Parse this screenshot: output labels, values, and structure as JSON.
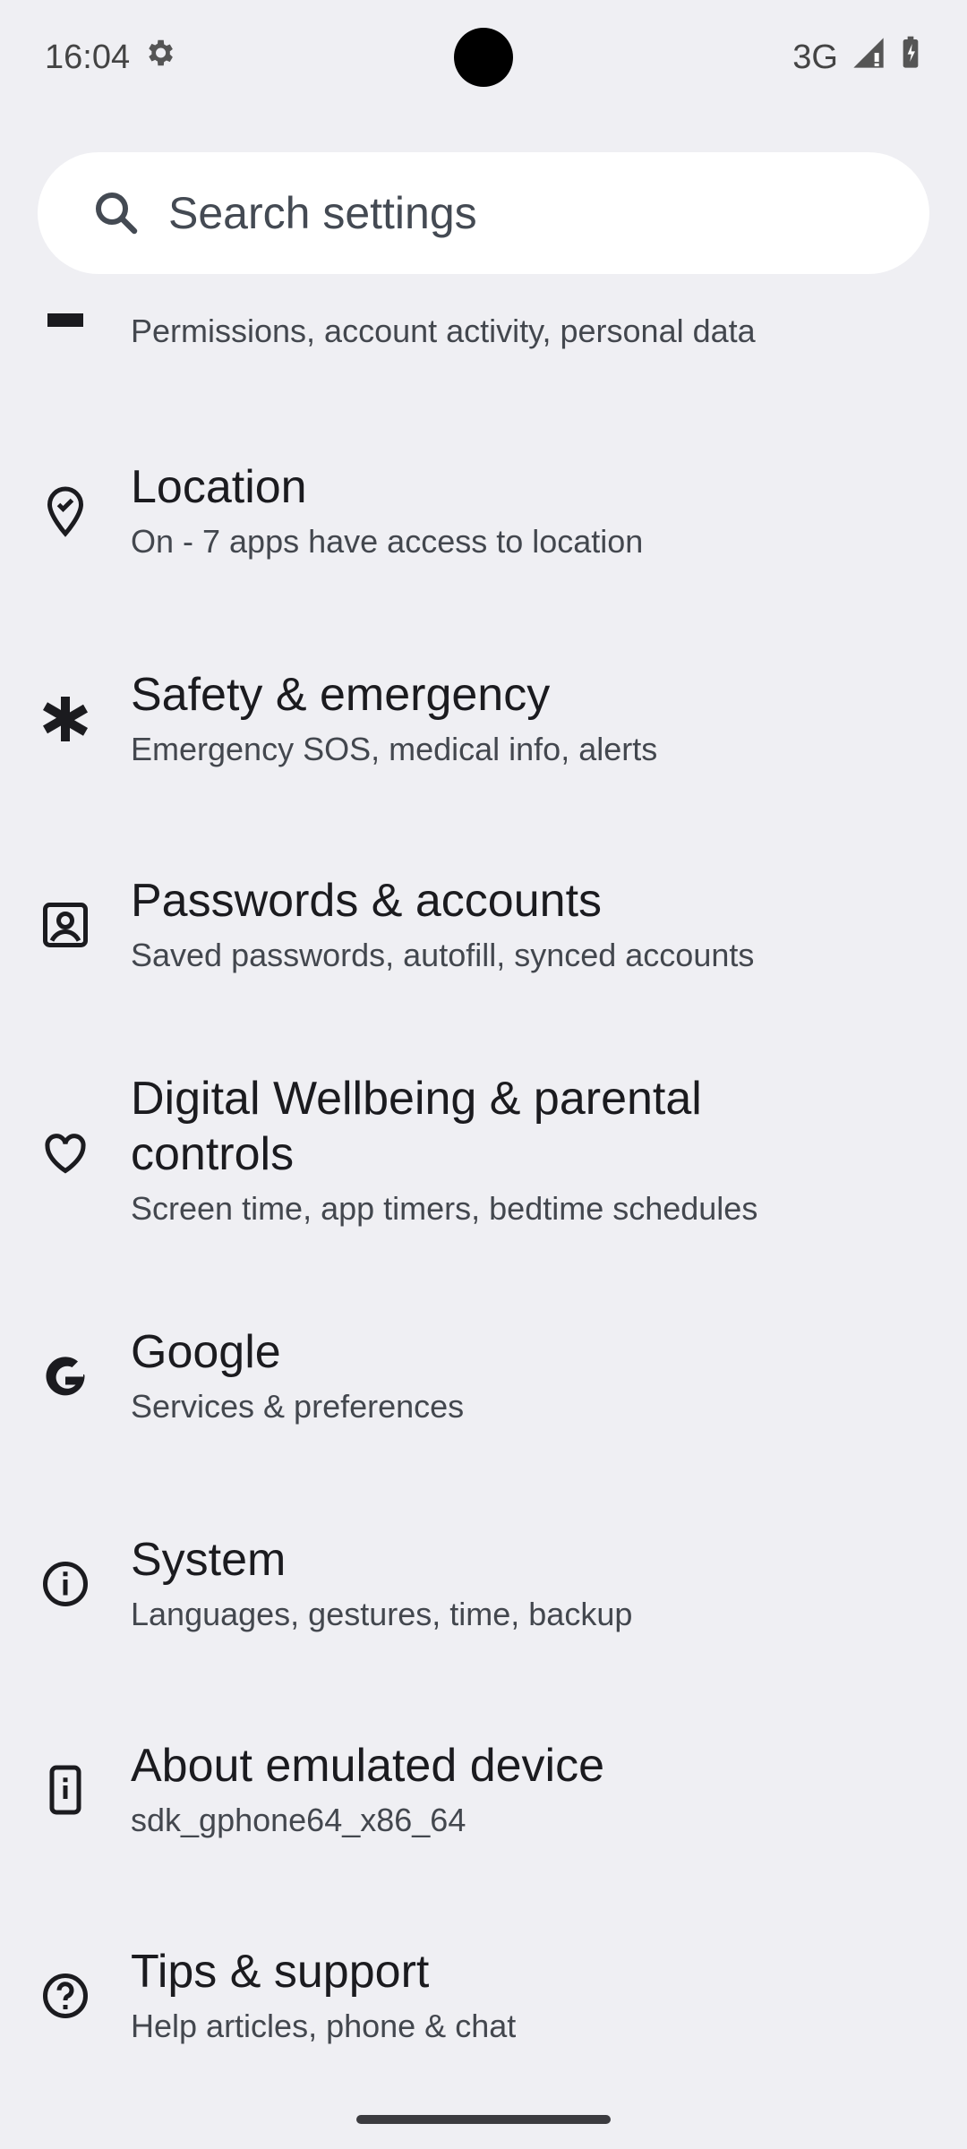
{
  "status_bar": {
    "time": "16:04",
    "network": "3G",
    "icons": [
      "settings-gear-icon",
      "signal-icon",
      "battery-icon"
    ]
  },
  "search": {
    "placeholder": "Search settings",
    "icon": "search-icon"
  },
  "settings_items": [
    {
      "title": "",
      "subtitle": "Permissions, account activity, personal data",
      "icon": "privacy-icon"
    },
    {
      "title": "Location",
      "subtitle": "On - 7 apps have access to location",
      "icon": "location-pin-icon"
    },
    {
      "title": "Safety & emergency",
      "subtitle": "Emergency SOS, medical info, alerts",
      "icon": "asterisk-medical-icon"
    },
    {
      "title": "Passwords & accounts",
      "subtitle": "Saved passwords, autofill, synced accounts",
      "icon": "accounts-icon"
    },
    {
      "title": "Digital Wellbeing & parental controls",
      "subtitle": "Screen time, app timers, bedtime schedules",
      "icon": "wellbeing-heart-icon"
    },
    {
      "title": "Google",
      "subtitle": "Services & preferences",
      "icon": "google-g-icon"
    },
    {
      "title": "System",
      "subtitle": "Languages, gestures, time, backup",
      "icon": "system-info-icon"
    },
    {
      "title": "About emulated device",
      "subtitle": "sdk_gphone64_x86_64",
      "icon": "device-phone-icon"
    },
    {
      "title": "Tips & support",
      "subtitle": "Help articles, phone & chat",
      "icon": "help-question-icon"
    }
  ],
  "colors": {
    "background": "#EFEFF3",
    "search_bg": "#FFFFFF",
    "title": "#1B1B1F",
    "subtitle": "#43474E"
  }
}
